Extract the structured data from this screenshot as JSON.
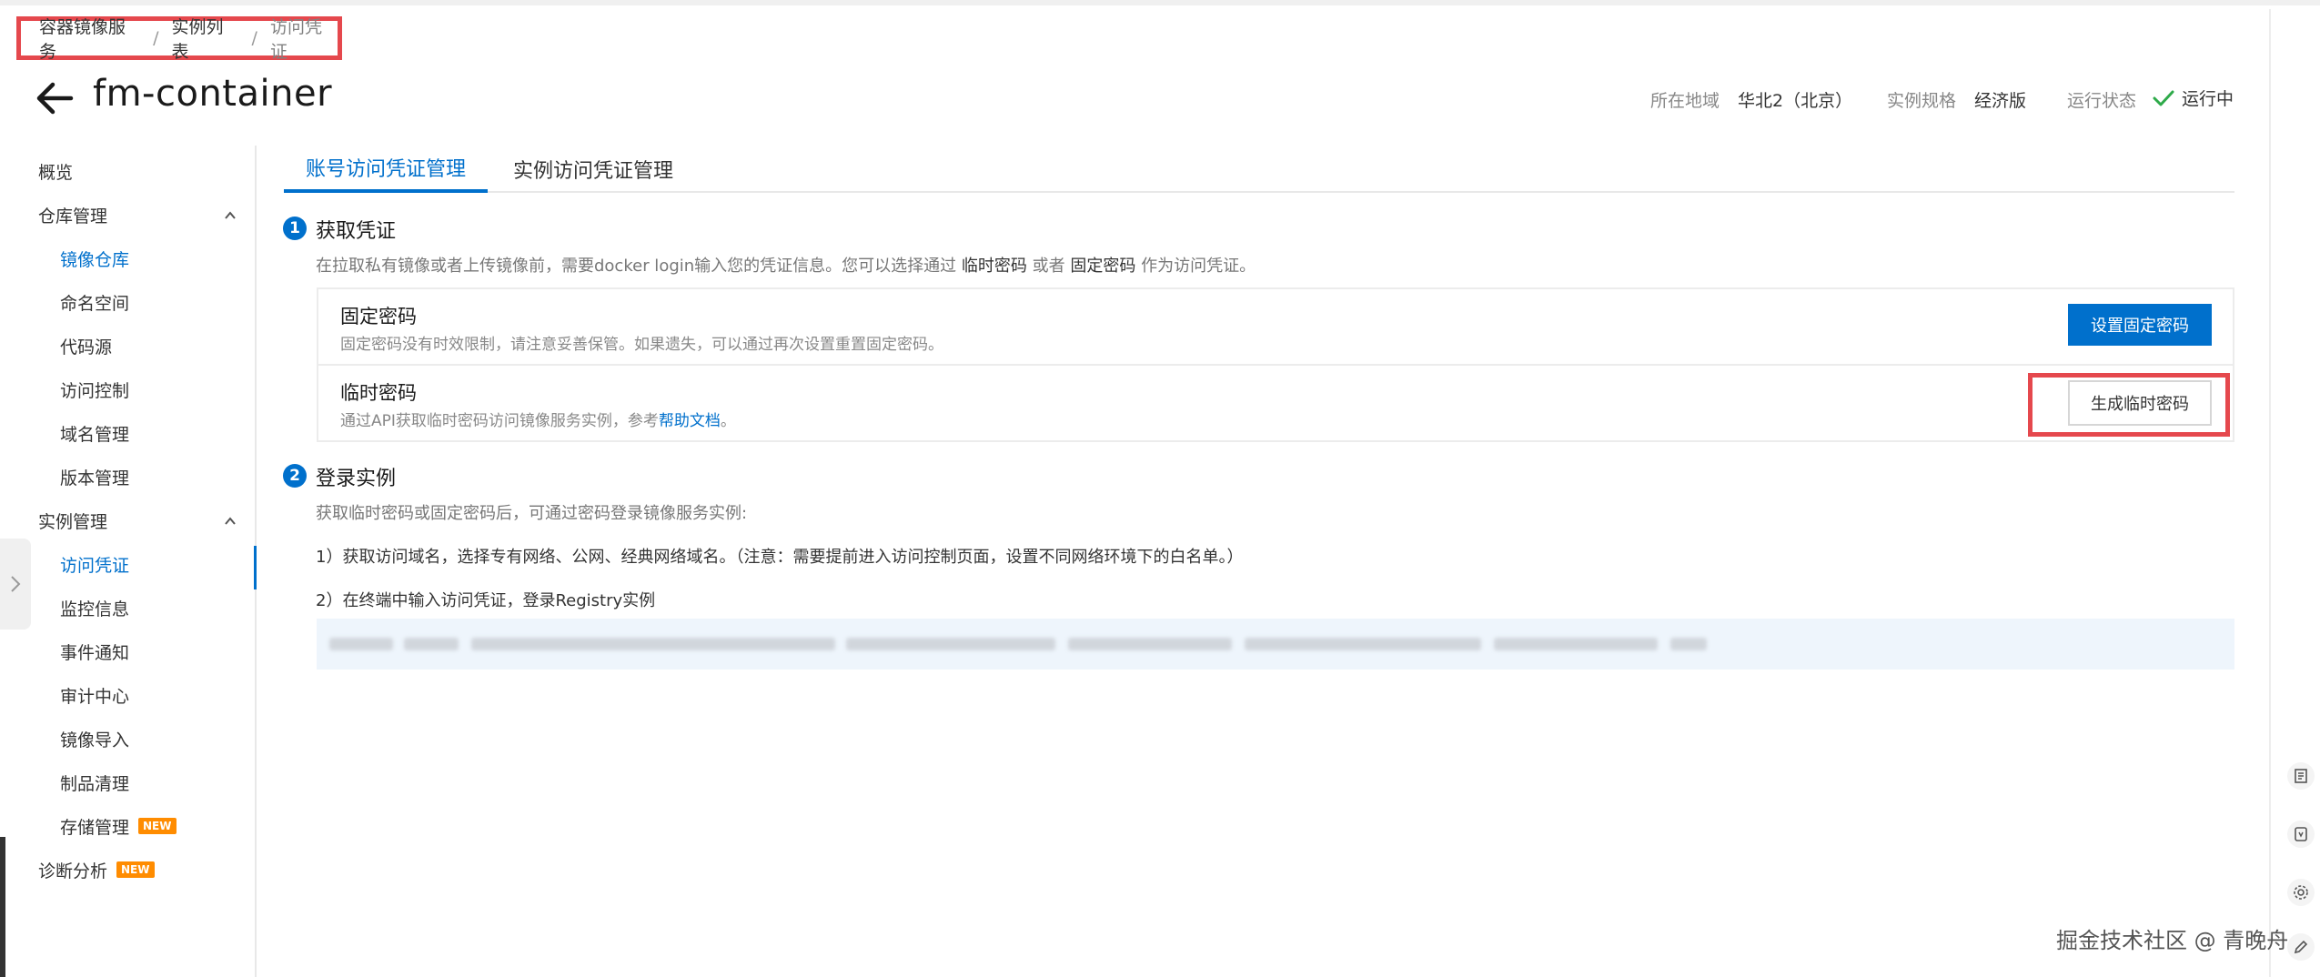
{
  "breadcrumb": {
    "items": [
      "容器镜像服务",
      "实例列表",
      "访问凭证"
    ],
    "separator": "/"
  },
  "header": {
    "title": "fm-container",
    "region_label": "所在地域",
    "region_value": "华北2（北京）",
    "spec_label": "实例规格",
    "spec_value": "经济版",
    "status_label": "运行状态",
    "status_value": "运行中"
  },
  "sidebar": {
    "overview": "概览",
    "repo_group": "仓库管理",
    "repo_items": [
      "镜像仓库",
      "命名空间",
      "代码源",
      "访问控制",
      "域名管理",
      "版本管理"
    ],
    "instance_group": "实例管理",
    "instance_items": [
      "访问凭证",
      "监控信息",
      "事件通知",
      "审计中心",
      "镜像导入",
      "制品清理",
      "存储管理"
    ],
    "diagnose": "诊断分析",
    "new_badge": "NEW"
  },
  "tabs": [
    "账号访问凭证管理",
    "实例访问凭证管理"
  ],
  "step1": {
    "num": "1",
    "title": "获取凭证",
    "desc_prefix": "在拉取私有镜像或者上传镜像前，需要docker login输入您的凭证信息。您可以选择通过",
    "desc_temp": "临时密码",
    "desc_or": "或者",
    "desc_fixed": "固定密码",
    "desc_suffix": "作为访问凭证。",
    "fixed_title": "固定密码",
    "fixed_desc": "固定密码没有时效限制，请注意妥善保管。如果遗失，可以通过再次设置重置固定密码。",
    "fixed_button": "设置固定密码",
    "temp_title": "临时密码",
    "temp_desc_prefix": "通过API获取临时密码访问镜像服务实例，参考",
    "temp_desc_link": "帮助文档",
    "temp_desc_suffix": "。",
    "temp_button": "生成临时密码"
  },
  "step2": {
    "num": "2",
    "title": "登录实例",
    "desc": "获取临时密码或固定密码后，可通过密码登录镜像服务实例:",
    "line1": "1）获取访问域名，选择专有网络、公网、经典网络域名。（注意：需要提前进入访问控制页面，设置不同网络环境下的白名单。）",
    "line2": "2）在终端中输入访问凭证，登录Registry实例"
  },
  "watermark": "掘金技术社区 @ 青晚舟",
  "colors": {
    "accent": "#0070cc",
    "highlight": "#e5484d",
    "status_ok": "#2eaa4a",
    "badge": "#ff8c00"
  }
}
